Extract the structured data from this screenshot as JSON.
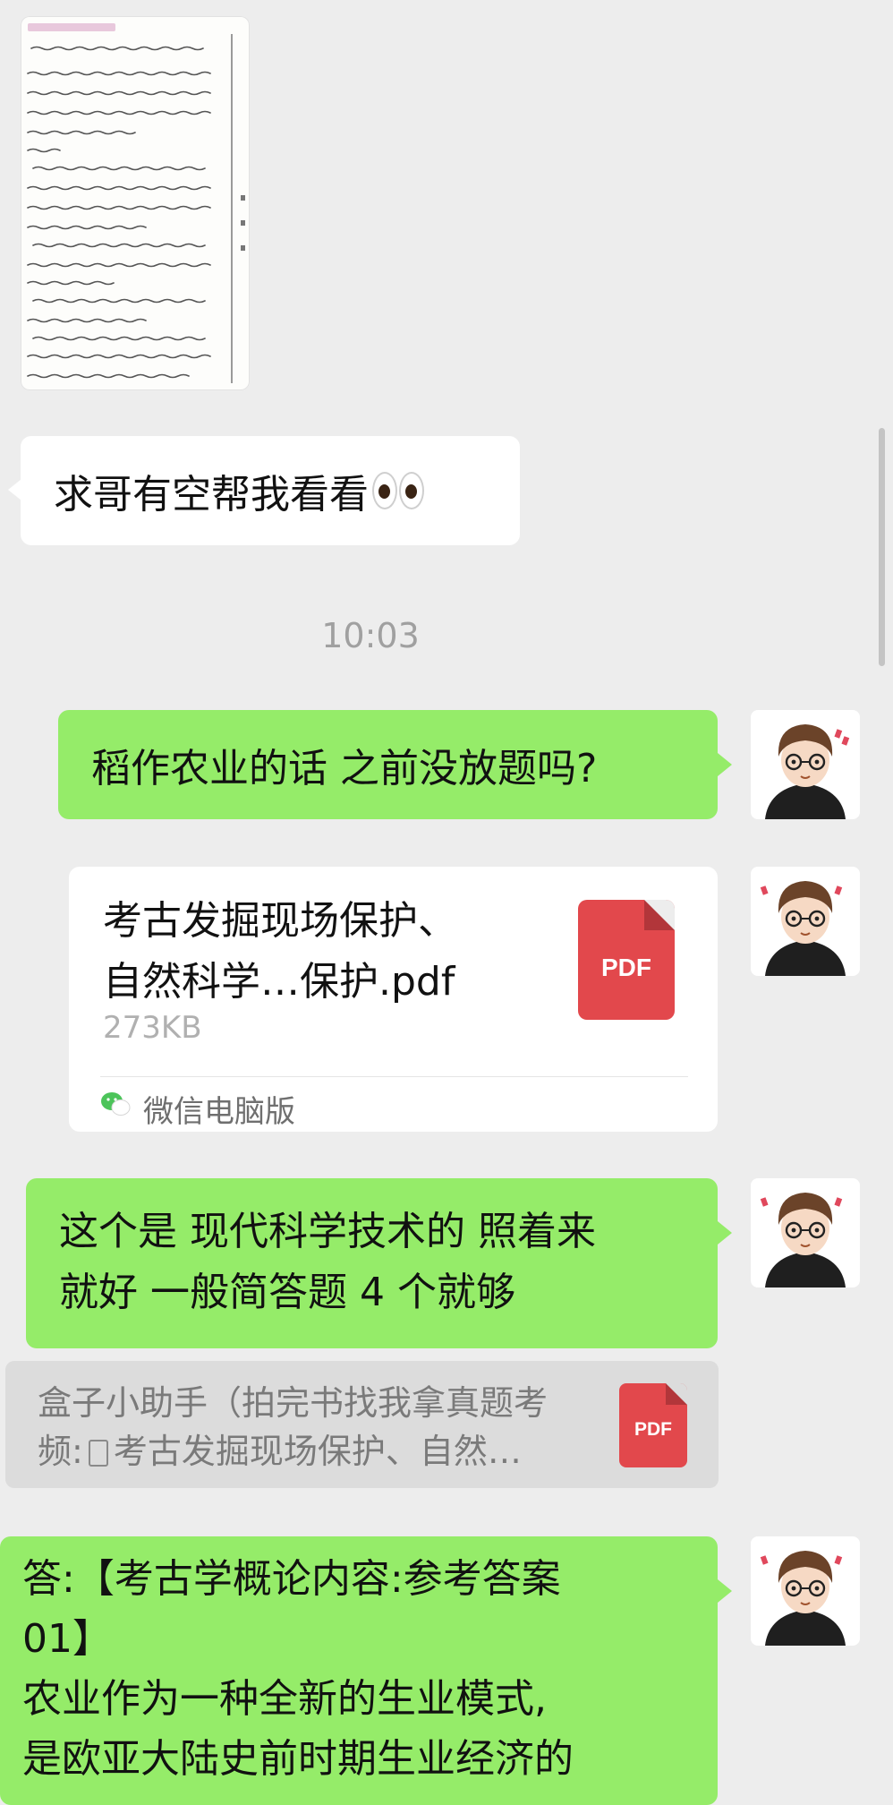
{
  "messages": {
    "left_text": "求哥有空帮我看看",
    "timestamp": "10:03",
    "green_1": "稻作农业的话 之前没放题吗?",
    "file": {
      "name_line1": "考古发掘现场保护、",
      "name_line2": "自然科学…保护.pdf",
      "size": "273KB",
      "badge": "PDF",
      "source": "微信电脑版"
    },
    "green_2_line1": "这个是 现代科学技术的 照着来",
    "green_2_line2": "就好 一般简答题 4 个就够",
    "quote": {
      "line1": "盒子小助手（拍完书找我拿真题考",
      "line2_prefix": "频:",
      "line2_suffix": "考古发掘现场保护、自然…",
      "badge": "PDF"
    },
    "green_3_line1": "答:【考古学概论内容:参考答案",
    "green_3_line2": "01】",
    "green_3_line3": "农业作为一种全新的生业模式,",
    "green_3_line4": "是欧亚大陆史前时期生业经济的"
  },
  "colors": {
    "chat_bg": "#ededed",
    "bubble_self": "#95ec69",
    "bubble_other": "#ffffff",
    "pdf_red": "#e2484c"
  },
  "icons": {
    "eyes": "eyes-emoji",
    "pdf": "pdf-file-icon",
    "source": "wechat-icon",
    "quote_doc": "document-icon"
  }
}
